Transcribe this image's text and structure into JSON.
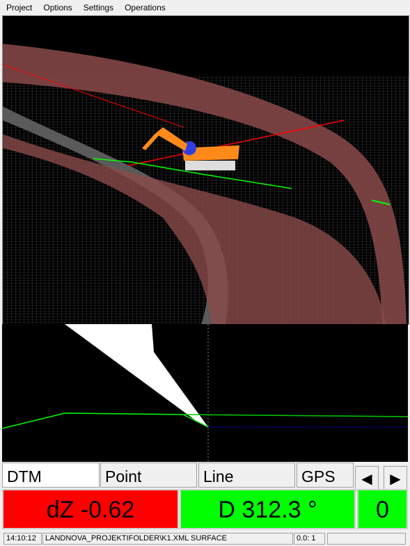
{
  "menu": [
    "Project",
    "Options",
    "Settings",
    "Operations"
  ],
  "tabs": [
    "DTM",
    "Point",
    "Line",
    "GPS"
  ],
  "nav": {
    "prev_icon": "triangle-left-icon",
    "next_icon": "triangle-right-icon"
  },
  "values": {
    "dz": "dZ -0.62",
    "direction": "D 312.3 °",
    "count": "0"
  },
  "colors": {
    "dz_bg": "#ff0000",
    "direction_bg": "#00ff00",
    "count_bg": "#00ff00"
  },
  "status": {
    "time": "14:10:12",
    "file": "LANDNOVA_PROJEKTIFOLDER\\K1.XML SURFACE",
    "coord": "0.0: 1",
    "extra": ""
  }
}
